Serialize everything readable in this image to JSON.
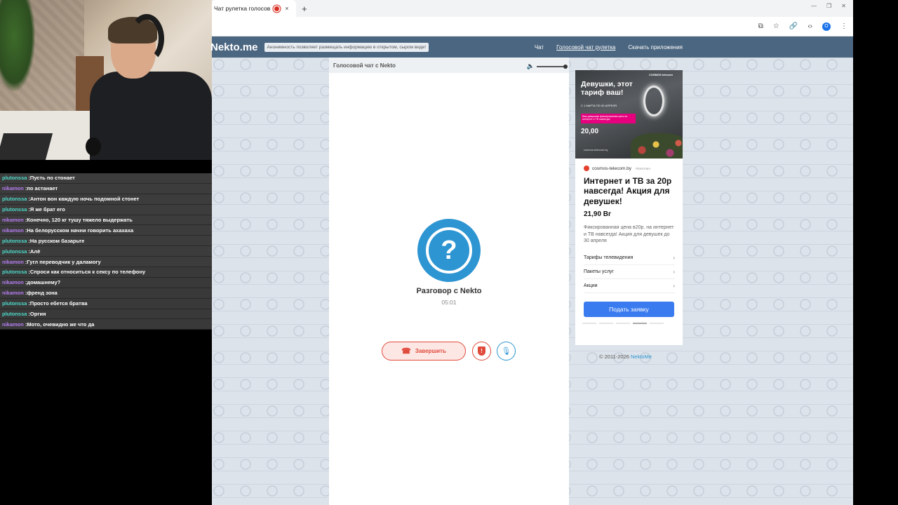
{
  "browser": {
    "tab_title": "Чат рулетка голосов",
    "tab_close": "×",
    "new_tab": "+",
    "win_controls": [
      "—",
      "❐",
      "✕"
    ],
    "profile_initial": "O"
  },
  "site": {
    "logo": "Nekto.me",
    "notice": "Анонимность позволяет размещать информацию в открытом, сыром виде!",
    "nav": [
      "Чат",
      "Голосовой чат рулетка",
      "Скачать приложения"
    ]
  },
  "panel": {
    "header": "Голосовой чат с Nekto",
    "call_icon": "?",
    "call_title": "Разговор с Nekto",
    "call_time": "05:01",
    "end_button": "Завершить",
    "report_icon": "!",
    "mic_icon": "🎙"
  },
  "ad": {
    "image_headline": "Девушки, этот тариф ваш!",
    "image_sub": "С 1 МАРТА ПО 30 АПРЕЛЯ",
    "image_pink": "Вам девушкам фиксированная цена на интернет и ТВ навсегда!",
    "image_price": "20,00",
    "image_site": "cosmos-telecom.by",
    "image_brand": "COSMOS telecom",
    "source": "cosmos-telecom.by",
    "source_label": "РЕКЛАМА",
    "title": "Интернет и ТВ за 20р навсегда! Акция для девушек!",
    "price": "21,90 Br",
    "description": "Фиксированная цена в20р. на интернет и ТВ навсегда! Акция для девушек до 30 апреля",
    "links": [
      "Тарифы телевидения",
      "Пакеты услуг",
      "Акции"
    ],
    "button": "Подать заявку"
  },
  "footer": {
    "copyright": "© 2011-2026",
    "link": "NektoMe"
  },
  "chat": [
    {
      "user": "plutonssa",
      "color": "#4dd9c8",
      "text": "Пусть по стонает"
    },
    {
      "user": "nikamon",
      "color": "#b57cf0",
      "text": "по астанает"
    },
    {
      "user": "plutonssa",
      "color": "#4dd9c8",
      "text": "Антон вон каждую ночь подомной стонет"
    },
    {
      "user": "plutonssa",
      "color": "#4dd9c8",
      "text": "Я же брат его"
    },
    {
      "user": "nikamon",
      "color": "#b57cf0",
      "text": "Конечно, 120 кг тушу тяжело выдержать"
    },
    {
      "user": "nikamon",
      "color": "#b57cf0",
      "text": "На белорусском начни говорить ахахаха"
    },
    {
      "user": "plutonssa",
      "color": "#4dd9c8",
      "text": "На русском базарьте"
    },
    {
      "user": "plutonssa",
      "color": "#4dd9c8",
      "text": "Алё"
    },
    {
      "user": "nikamon",
      "color": "#b57cf0",
      "text": "Гугл переводчик у даламогу"
    },
    {
      "user": "plutonssa",
      "color": "#4dd9c8",
      "text": "Спроси как относиться к сексу по телефону"
    },
    {
      "user": "nikamon",
      "color": "#b57cf0",
      "text": "домашнему?"
    },
    {
      "user": "nikamon",
      "color": "#b57cf0",
      "text": "френд зона"
    },
    {
      "user": "plutonssa",
      "color": "#4dd9c8",
      "text": "Просто ебется братва"
    },
    {
      "user": "plutonssa",
      "color": "#4dd9c8",
      "text": "Оргия"
    },
    {
      "user": "nikamon",
      "color": "#b57cf0",
      "text": "Мото, очевидно же что да"
    }
  ]
}
